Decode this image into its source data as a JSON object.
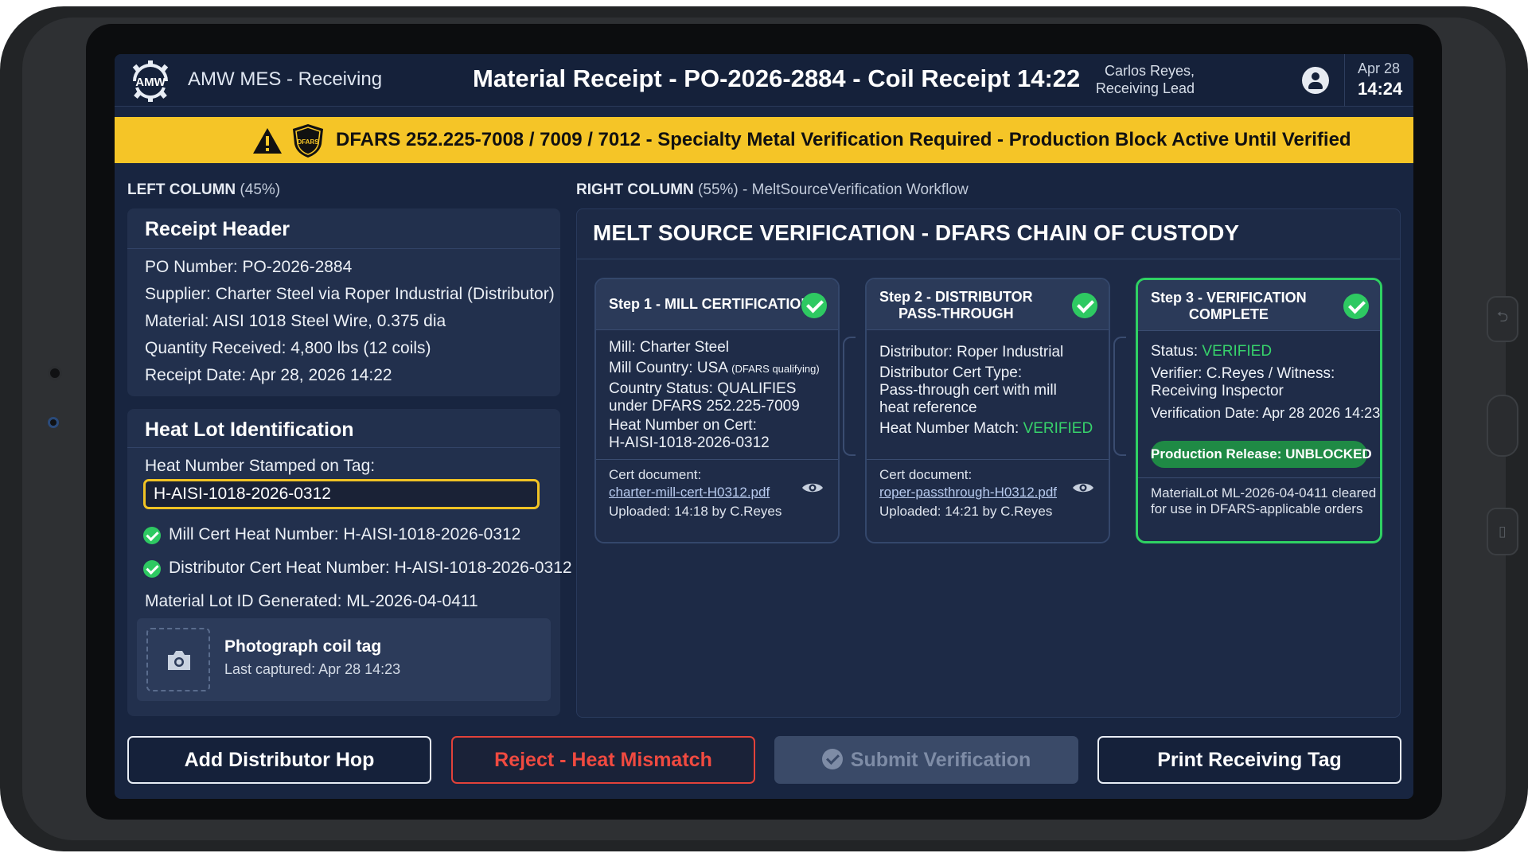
{
  "header": {
    "logo_text": "AMW",
    "app_name": "AMW MES - Receiving",
    "page_title": "Material Receipt - PO-2026-2884 - Coil Receipt 14:22",
    "user_name": "Carlos Reyes,",
    "user_role": "Receiving Lead",
    "date": "Apr 28",
    "time": "14:24"
  },
  "banner": {
    "badge_text": "DFARS",
    "text": "DFARS 252.225-7008 / 7009 / 7012 - Specialty Metal Verification Required - Production Block Active Until Verified",
    "color": "#f5c527"
  },
  "left_column": {
    "label_strong": "LEFT COLUMN",
    "label_rest": " (45%)",
    "receipt_header": {
      "title": "Receipt Header",
      "lines": [
        "PO Number: PO-2026-2884",
        "Supplier: Charter Steel via Roper Industrial (Distributor)",
        "Material: AISI 1018 Steel Wire, 0.375 dia",
        "Quantity Received: 4,800 lbs (12 coils)",
        "Receipt Date: Apr 28, 2026 14:22"
      ]
    },
    "heat_lot": {
      "title": "Heat Lot Identification",
      "field_label": "Heat Number Stamped on Tag:",
      "field_value": "H-AISI-1018-2026-0312",
      "check_1": "Mill Cert Heat Number: H-AISI-1018-2026-0312",
      "check_2": "Distributor Cert Heat Number: H-AISI-1018-2026-0312",
      "lot_generated": "Material Lot ID Generated: ML-2026-04-0411",
      "photo_title": "Photograph coil tag",
      "photo_sub": "Last captured: Apr 28 14:23"
    }
  },
  "right_column": {
    "label_strong": "RIGHT COLUMN",
    "label_rest": " (55%) - MeltSourceVerification Workflow",
    "title": "MELT SOURCE VERIFICATION - DFARS CHAIN OF CUSTODY",
    "steps": [
      {
        "title": "Step 1 - MILL CERTIFICATION",
        "mill": "Mill: Charter Steel",
        "country": "Mill Country: USA ",
        "country_note": "(DFARS qualifying)",
        "status_1": "Country Status: QUALIFIES",
        "status_2": "under DFARS 252.225-7009",
        "heat_1": "Heat Number on Cert:",
        "heat_2": "H-AISI-1018-2026-0312",
        "doc_label": "Cert document:",
        "doc_link": "charter-mill-cert-H0312.pdf",
        "uploaded": "Uploaded: 14:18 by C.Reyes"
      },
      {
        "title_1": "Step 2 - DISTRIBUTOR",
        "title_2": "PASS-THROUGH",
        "distributor": "Distributor: Roper Industrial",
        "cert_type_1": "Distributor Cert Type:",
        "cert_type_2": "Pass-through cert with mill",
        "cert_type_3": "heat reference",
        "match_label": "Heat Number Match: ",
        "match_value": "VERIFIED",
        "doc_label": "Cert document:",
        "doc_link": "roper-passthrough-H0312.pdf",
        "uploaded": "Uploaded: 14:21 by C.Reyes"
      },
      {
        "title_1": "Step 3 - VERIFICATION",
        "title_2": "COMPLETE",
        "status_label": "Status: ",
        "status_value": "VERIFIED",
        "verifier_1": "Verifier: C.Reyes / Witness:",
        "verifier_2": "Receiving Inspector",
        "verif_date": "Verification Date: Apr 28 2026 14:23",
        "release_badge": "Production Release: UNBLOCKED",
        "cleared_1": "MaterialLot ML-2026-04-0411 cleared",
        "cleared_2": "for use in DFARS-applicable orders"
      }
    ]
  },
  "buttons": {
    "add_hop": "Add Distributor Hop",
    "reject": "Reject - Heat Mismatch",
    "submit": "Submit Verification",
    "print_tag": "Print Receiving Tag"
  },
  "colors": {
    "screen_bg": "#182540",
    "accent_yellow": "#f5c527",
    "success_green": "#2ec962",
    "danger_red": "#e2423a"
  }
}
